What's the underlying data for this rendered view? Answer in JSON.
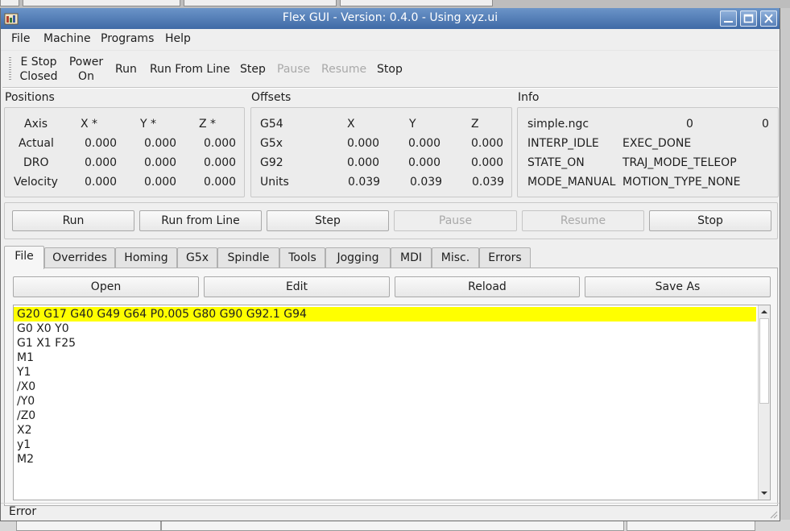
{
  "window": {
    "title": "Flex GUI - Version: 0.4.0 - Using xyz.ui"
  },
  "menu": [
    "File",
    "Machine",
    "Programs",
    "Help"
  ],
  "toolbar": {
    "estop": {
      "line1": "E Stop",
      "line2": "Closed"
    },
    "power": {
      "line1": "Power",
      "line2": "On"
    },
    "run": "Run",
    "run_from_line": "Run From Line",
    "step": "Step",
    "pause": "Pause",
    "resume": "Resume",
    "stop": "Stop"
  },
  "positions": {
    "title": "Positions",
    "header": [
      "Axis",
      "X *",
      "Y *",
      "Z *"
    ],
    "rows": [
      {
        "label": "Actual",
        "x": "0.000",
        "y": "0.000",
        "z": "0.000"
      },
      {
        "label": "DRO",
        "x": "0.000",
        "y": "0.000",
        "z": "0.000"
      },
      {
        "label": "Velocity",
        "x": "0.000",
        "y": "0.000",
        "z": "0.000"
      }
    ]
  },
  "offsets": {
    "title": "Offsets",
    "header": [
      "G54",
      "X",
      "Y",
      "Z"
    ],
    "rows": [
      {
        "label": "G5x",
        "x": "0.000",
        "y": "0.000",
        "z": "0.000"
      },
      {
        "label": "G92",
        "x": "0.000",
        "y": "0.000",
        "z": "0.000"
      },
      {
        "label": "Units",
        "x": "0.039",
        "y": "0.039",
        "z": "0.039"
      }
    ]
  },
  "info": {
    "title": "Info",
    "file": "simple.ngc",
    "line_a": "0",
    "line_b": "0",
    "interp_state": "INTERP_IDLE",
    "exec_state": "EXEC_DONE",
    "task_state": "STATE_ON",
    "traj_mode": "TRAJ_MODE_TELEOP",
    "task_mode": "MODE_MANUAL",
    "motion_type": "MOTION_TYPE_NONE"
  },
  "buttons": {
    "run": "Run",
    "run_from_line": "Run from Line",
    "step": "Step",
    "pause": "Pause",
    "resume": "Resume",
    "stop": "Stop"
  },
  "tabs": [
    "File",
    "Overrides",
    "Homing",
    "G5x",
    "Spindle",
    "Tools",
    "Jogging",
    "MDI",
    "Misc.",
    "Errors"
  ],
  "file_tab": {
    "open": "Open",
    "edit": "Edit",
    "reload": "Reload",
    "save_as": "Save As",
    "lines": [
      "G20 G17 G40 G49 G64 P0.005 G80 G90 G92.1 G94",
      "G0 X0 Y0",
      "G1 X1 F25",
      "M1",
      "Y1",
      "/X0",
      "/Y0",
      "/Z0",
      "X2",
      "y1",
      "M2"
    ]
  },
  "status": {
    "message": "Error"
  },
  "colors": {
    "titlebar": "#4a76b2",
    "current_line": "#ffff00"
  }
}
